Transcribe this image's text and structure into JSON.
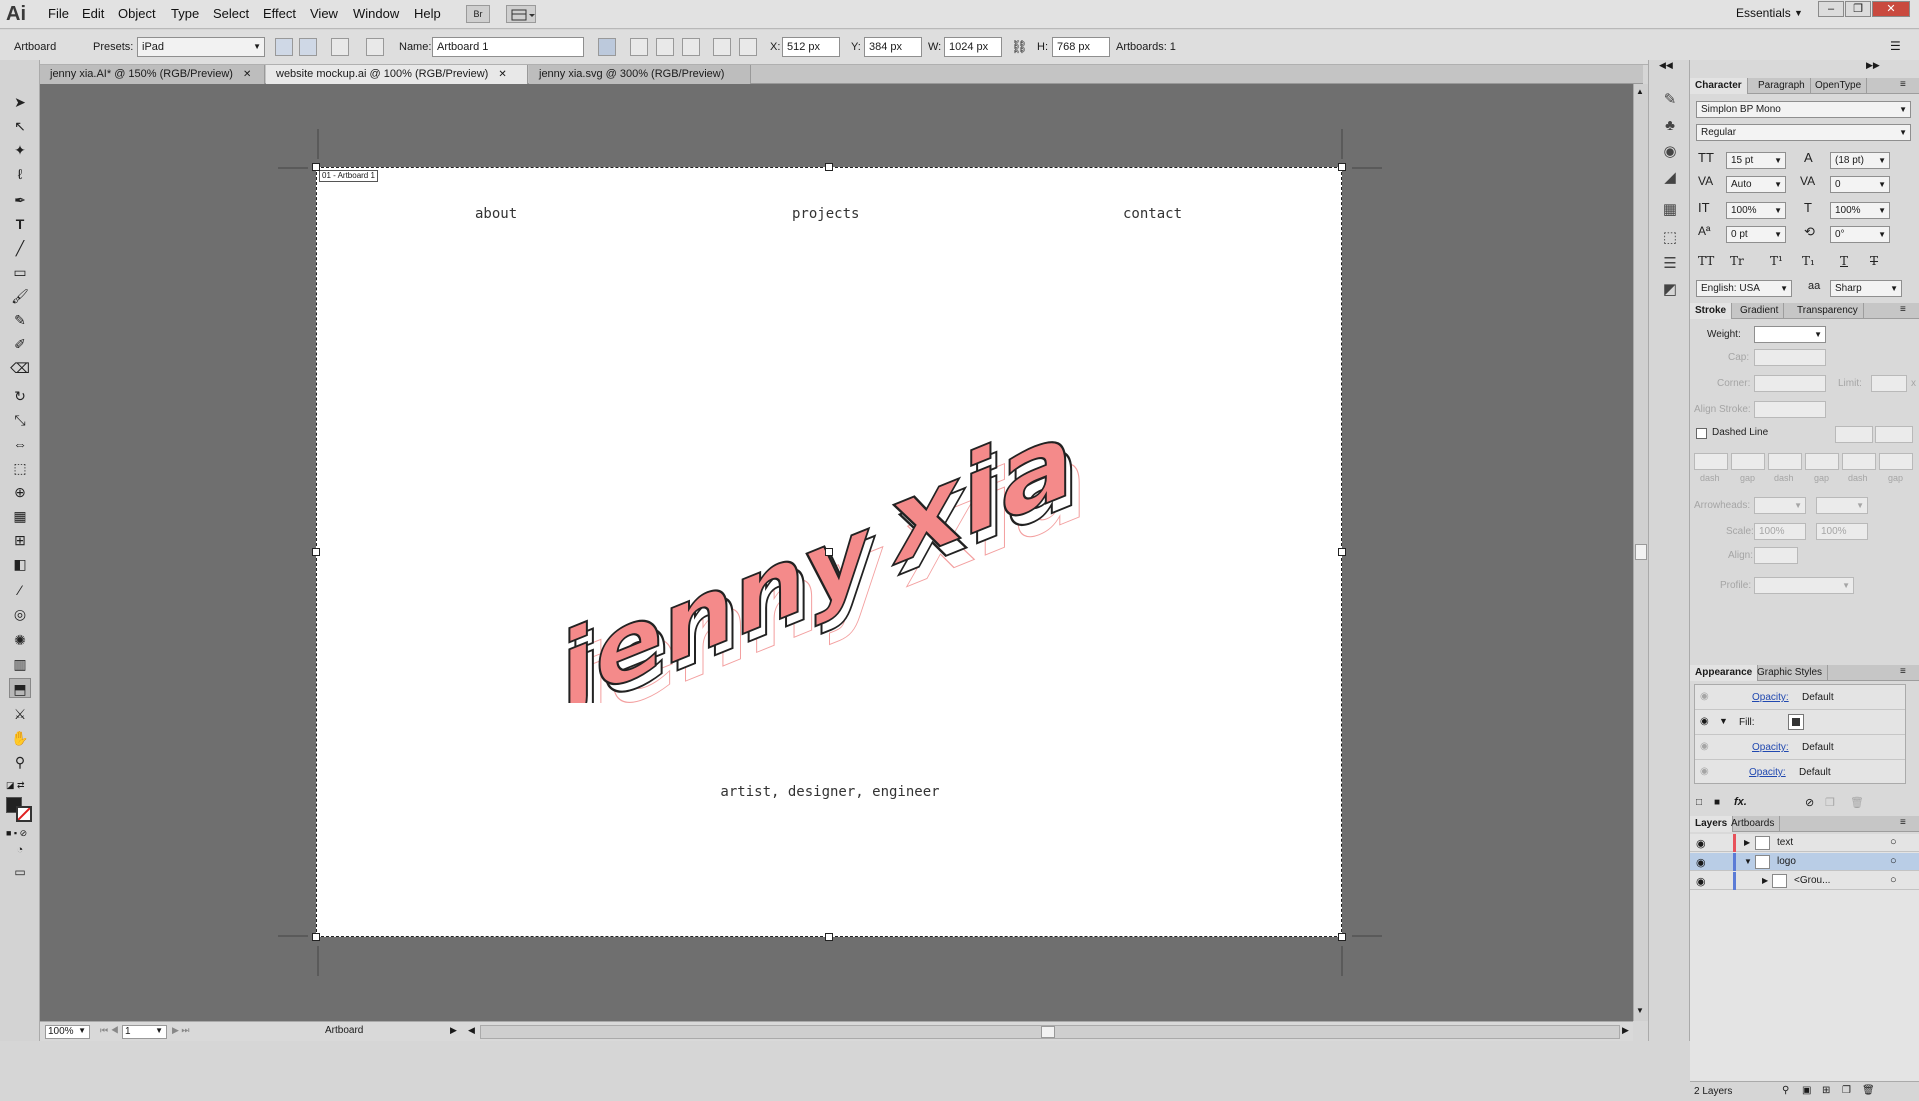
{
  "app": {
    "logo": "Ai"
  },
  "menu": [
    "File",
    "Edit",
    "Object",
    "Type",
    "Select",
    "Effect",
    "View",
    "Window",
    "Help"
  ],
  "menubar": {
    "bridge_label": "Br",
    "workspace": "Essentials"
  },
  "control": {
    "selection_label": "Artboard",
    "presets_label": "Presets:",
    "presets_value": "iPad",
    "name_label": "Name:",
    "name_value": "Artboard 1",
    "x_label": "X:",
    "x_value": "512 px",
    "y_label": "Y:",
    "y_value": "384 px",
    "w_label": "W:",
    "w_value": "1024 px",
    "h_label": "H:",
    "h_value": "768 px",
    "artboards_count": "Artboards: 1"
  },
  "tabs": [
    {
      "label": "jenny xia.AI* @ 150% (RGB/Preview)",
      "active": false
    },
    {
      "label": "website mockup.ai @ 100% (RGB/Preview)",
      "active": true
    },
    {
      "label": "jenny xia.svg @ 300% (RGB/Preview)",
      "active": false
    }
  ],
  "artboard": {
    "label": "01 - Artboard 1",
    "nav": [
      "about",
      "projects",
      "contact"
    ],
    "logo_text": [
      "jenny",
      "xia"
    ],
    "tagline": "artist, designer, engineer"
  },
  "status": {
    "zoom": "100%",
    "page": "1",
    "mode": "Artboard"
  },
  "character": {
    "tabs": [
      "Character",
      "Paragraph",
      "OpenType"
    ],
    "font": "Simplon BP Mono",
    "style": "Regular",
    "size": "15 pt",
    "leading": "(18 pt)",
    "kerning": "Auto",
    "tracking": "0",
    "vscale": "100%",
    "hscale": "100%",
    "baseline": "0 pt",
    "rotation": "0°",
    "language": "English: USA",
    "antialias": "Sharp",
    "caps_labels": [
      "TT",
      "Tr",
      "T¹",
      "T₁",
      "T",
      "T"
    ],
    "aa_label": "aa"
  },
  "stroke": {
    "tabs": [
      "Stroke",
      "Gradient",
      "Transparency"
    ],
    "weight_label": "Weight:",
    "cap_label": "Cap:",
    "corner_label": "Corner:",
    "limit_label": "Limit:",
    "limit_x": "x",
    "align_label": "Align Stroke:",
    "dashed_label": "Dashed Line",
    "dash_labels": [
      "dash",
      "gap",
      "dash",
      "gap",
      "dash",
      "gap"
    ],
    "arrowheads_label": "Arrowheads:",
    "scale_label": "Scale:",
    "scale1": "100%",
    "scale2": "100%",
    "align2_label": "Align:",
    "profile_label": "Profile:"
  },
  "appearance": {
    "tabs": [
      "Appearance",
      "Graphic Styles"
    ],
    "rows": [
      {
        "label": "Opacity:",
        "value": "Default"
      },
      {
        "label": "Fill:",
        "value": ""
      },
      {
        "label": "Opacity:",
        "value": "Default"
      },
      {
        "label": "Opacity:",
        "value": "Default"
      }
    ],
    "fx_label": "fx."
  },
  "layers": {
    "tabs": [
      "Layers",
      "Artboards"
    ],
    "items": [
      {
        "name": "text",
        "color": "#e8525b",
        "selected": false,
        "expanded": false,
        "indent": 0
      },
      {
        "name": "logo",
        "color": "#5b7bd6",
        "selected": true,
        "expanded": true,
        "indent": 0
      },
      {
        "name": "<Grou...",
        "color": "#5b7bd6",
        "selected": false,
        "expanded": false,
        "indent": 1
      }
    ],
    "count": "2 Layers"
  },
  "colors": {
    "accent_pink": "#f08080",
    "canvas": "#6f6f6f"
  }
}
